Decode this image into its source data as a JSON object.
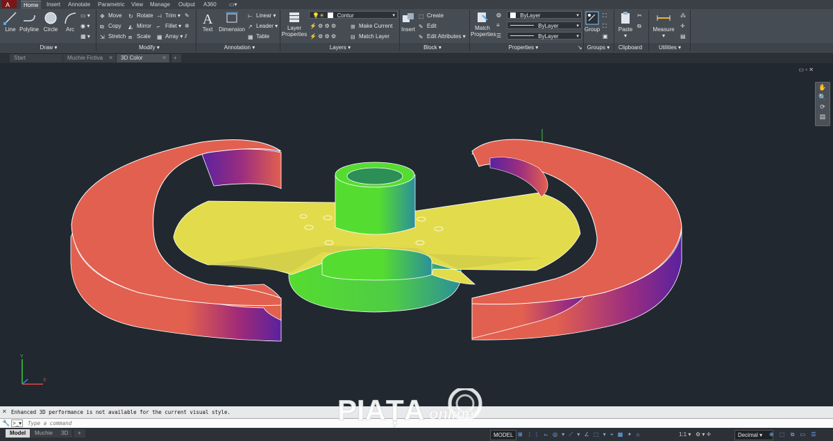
{
  "app": {
    "logo_text": "A"
  },
  "ribbon_tabs": [
    "Home",
    "Insert",
    "Annotate",
    "Parametric",
    "View",
    "Manage",
    "Output",
    "A360"
  ],
  "active_ribbon_tab": "Home",
  "draw": {
    "title": "Draw",
    "line": "Line",
    "polyline": "Polyline",
    "circle": "Circle",
    "arc": "Arc"
  },
  "modify": {
    "title": "Modify",
    "move": "Move",
    "rotate": "Rotate",
    "trim": "Trim",
    "copy": "Copy",
    "mirror": "Mirror",
    "fillet": "Fillet",
    "stretch": "Stretch",
    "scale": "Scale",
    "array": "Array"
  },
  "annotation": {
    "title": "Annotation",
    "text": "Text",
    "dimension": "Dimension",
    "linear": "Linear",
    "leader": "Leader",
    "table": "Table"
  },
  "layers": {
    "title": "Layers",
    "layer_properties_1": "Layer",
    "layer_properties_2": "Properties",
    "current_layer": "Contur",
    "make_current": "Make Current",
    "match_layer": "Match Layer"
  },
  "block": {
    "title": "Block",
    "insert": "Insert",
    "create": "Create",
    "edit": "Edit",
    "edit_attributes": "Edit Attributes"
  },
  "properties": {
    "title": "Properties",
    "match_properties_1": "Match",
    "match_properties_2": "Properties",
    "color": "ByLayer",
    "linetype": "ByLayer",
    "lineweight": "ByLayer"
  },
  "groups": {
    "title": "Groups",
    "group": "Group"
  },
  "clipboard": {
    "title": "Clipboard",
    "paste": "Paste"
  },
  "utilities": {
    "title": "Utilities",
    "measure": "Measure"
  },
  "doc_tabs": [
    {
      "label": "Start",
      "active": false
    },
    {
      "label": "Muchie Fictiva",
      "active": false
    },
    {
      "label": "3D Color",
      "active": true
    }
  ],
  "command": {
    "history": "Enhanced 3D performance is not available for the current visual style.",
    "placeholder": "Type a command"
  },
  "layout_tabs": [
    "Model",
    "Muchie",
    "3D"
  ],
  "active_layout": "Model",
  "status": {
    "model": "MODEL",
    "scale": "1:1",
    "units": "Decimal"
  },
  "ucs": {
    "x": "X",
    "y": "Y"
  },
  "watermark": {
    "brand": "PIAȚA",
    "suffix": "online"
  },
  "colors": {
    "ring_red": "#e2604f",
    "ring_purple": "#5a229e",
    "plate_yellow": "#e2dc4c",
    "hub_green": "#55dc30",
    "hub_teal": "#2c8f99",
    "background": "#212830",
    "crosshair": "#3cc83c"
  }
}
